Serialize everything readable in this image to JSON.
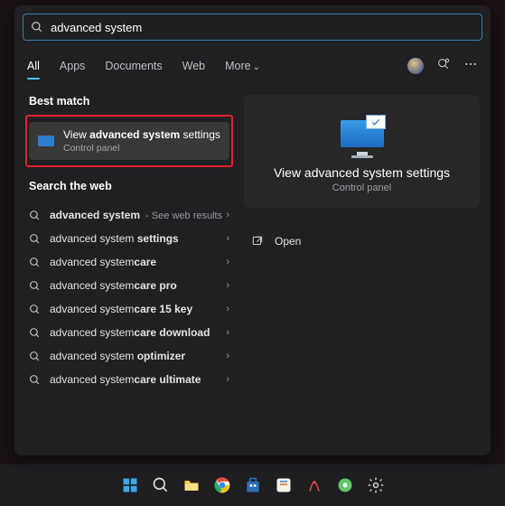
{
  "search": {
    "query": "advanced system"
  },
  "tabs": {
    "all": "All",
    "apps": "Apps",
    "documents": "Documents",
    "web": "Web",
    "more": "More"
  },
  "left": {
    "best_match_label": "Best match",
    "best_match": {
      "title_html": "View <b>advanced system</b> settings",
      "subtitle": "Control panel"
    },
    "search_web_label": "Search the web",
    "web_items": [
      {
        "html": "<b>advanced system</b>",
        "hint": " - See web results"
      },
      {
        "html": "advanced system <b>settings</b>",
        "hint": ""
      },
      {
        "html": "advanced system<b>care</b>",
        "hint": ""
      },
      {
        "html": "advanced system<b>care pro</b>",
        "hint": ""
      },
      {
        "html": "advanced system<b>care 15 key</b>",
        "hint": ""
      },
      {
        "html": "advanced system<b>care download</b>",
        "hint": ""
      },
      {
        "html": "advanced system <b>optimizer</b>",
        "hint": ""
      },
      {
        "html": "advanced system<b>care ultimate</b>",
        "hint": ""
      }
    ]
  },
  "preview": {
    "title": "View advanced system settings",
    "subtitle": "Control panel",
    "open_label": "Open"
  }
}
